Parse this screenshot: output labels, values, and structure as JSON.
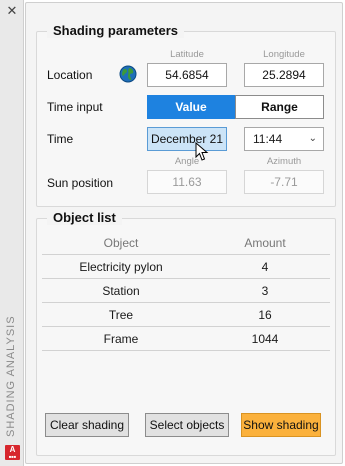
{
  "sidebar": {
    "title": "SHADING ANALYSIS",
    "close_glyph": "✕",
    "app_logo": "A"
  },
  "params": {
    "title": "Shading parameters",
    "location_label": "Location",
    "latitude_header": "Latitude",
    "longitude_header": "Longitude",
    "latitude": "54.6854",
    "longitude": "25.2894",
    "time_input_label": "Time input",
    "toggle_value": "Value",
    "toggle_range": "Range",
    "toggle_selected": "Value",
    "time_label": "Time",
    "date": "December 21",
    "time": "11:44",
    "angle_header": "Angle",
    "azimuth_header": "Azimuth",
    "sun_position_label": "Sun position",
    "angle": "11.63",
    "azimuth": "-7.71"
  },
  "objects": {
    "title": "Object list",
    "col_object": "Object",
    "col_amount": "Amount",
    "rows": [
      {
        "object": "Electricity pylon",
        "amount": "4"
      },
      {
        "object": "Station",
        "amount": "3"
      },
      {
        "object": "Tree",
        "amount": "16"
      },
      {
        "object": "Frame",
        "amount": "1044"
      }
    ]
  },
  "actions": {
    "clear": "Clear shading",
    "select": "Select objects",
    "show": "Show shading"
  },
  "colors": {
    "accent": "#1e82e0",
    "primary_button": "#fbb13c",
    "date_highlight": "#cce4f7"
  }
}
